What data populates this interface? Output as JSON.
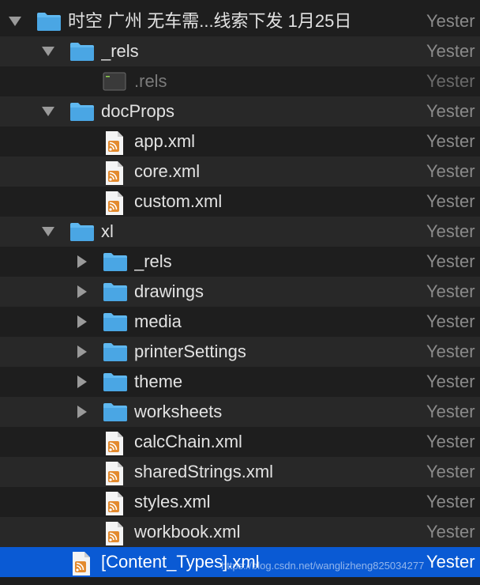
{
  "date_label": "Yester",
  "colors": {
    "folder": "#5fb8f0",
    "feed": "#e38a2e",
    "selection": "#0a5ad4"
  },
  "watermark": "https://blog.csdn.net/wanglizheng825034277",
  "rows": [
    {
      "name": "时空 广州 无车需...线索下发 1月25日",
      "kind": "folder",
      "depth": 0,
      "disclosure": "open"
    },
    {
      "name": "_rels",
      "kind": "folder",
      "depth": 1,
      "disclosure": "open"
    },
    {
      "name": ".rels",
      "kind": "exec",
      "depth": 2,
      "disclosure": "none",
      "dim": true
    },
    {
      "name": "docProps",
      "kind": "folder",
      "depth": 1,
      "disclosure": "open"
    },
    {
      "name": "app.xml",
      "kind": "xml",
      "depth": 2,
      "disclosure": "none"
    },
    {
      "name": "core.xml",
      "kind": "xml",
      "depth": 2,
      "disclosure": "none"
    },
    {
      "name": "custom.xml",
      "kind": "xml",
      "depth": 2,
      "disclosure": "none"
    },
    {
      "name": "xl",
      "kind": "folder",
      "depth": 1,
      "disclosure": "open"
    },
    {
      "name": "_rels",
      "kind": "folder",
      "depth": 2,
      "disclosure": "closed"
    },
    {
      "name": "drawings",
      "kind": "folder",
      "depth": 2,
      "disclosure": "closed"
    },
    {
      "name": "media",
      "kind": "folder",
      "depth": 2,
      "disclosure": "closed"
    },
    {
      "name": "printerSettings",
      "kind": "folder",
      "depth": 2,
      "disclosure": "closed"
    },
    {
      "name": "theme",
      "kind": "folder",
      "depth": 2,
      "disclosure": "closed"
    },
    {
      "name": "worksheets",
      "kind": "folder",
      "depth": 2,
      "disclosure": "closed"
    },
    {
      "name": "calcChain.xml",
      "kind": "xml",
      "depth": 2,
      "disclosure": "none"
    },
    {
      "name": "sharedStrings.xml",
      "kind": "xml",
      "depth": 2,
      "disclosure": "none"
    },
    {
      "name": "styles.xml",
      "kind": "xml",
      "depth": 2,
      "disclosure": "none"
    },
    {
      "name": "workbook.xml",
      "kind": "xml",
      "depth": 2,
      "disclosure": "none"
    },
    {
      "name": "[Content_Types].xml",
      "kind": "xml",
      "depth": 1,
      "disclosure": "none",
      "selected": true
    }
  ]
}
